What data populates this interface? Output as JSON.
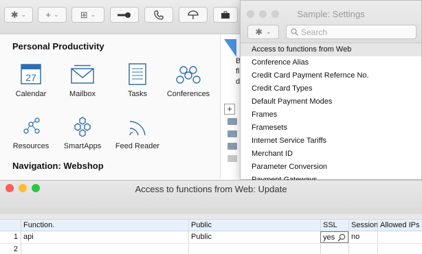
{
  "toolbar": {
    "gear_glyph": "✱",
    "add_glyph": "+",
    "grid_glyph": "⊞"
  },
  "personal": {
    "title": "Personal Productivity",
    "apps": [
      {
        "label": "Calendar",
        "badge": "27"
      },
      {
        "label": "Mailbox"
      },
      {
        "label": "Tasks"
      },
      {
        "label": "Conferences"
      },
      {
        "label": "Resources"
      },
      {
        "label": "SmartApps"
      },
      {
        "label": "Feed Reader"
      }
    ]
  },
  "navigation": {
    "title": "Navigation: Webshop"
  },
  "right_panel": {
    "lines": [
      "B",
      "fl",
      "d"
    ]
  },
  "popup": {
    "title": "Sample: Settings",
    "search_placeholder": "Search",
    "items": [
      "Access to functions from Web",
      "Conference Alias",
      "Credit Card Payment Refernce No.",
      "Credit Card Types",
      "Default Payment Modes",
      "Frames",
      "Framesets",
      "Internet Service Tariffs",
      "Merchant ID",
      "Parameter Conversion",
      "Payment Gateways"
    ],
    "selected_index": 0
  },
  "window": {
    "title": "Access to functions from Web: Update"
  },
  "grid": {
    "columns": [
      "Function.",
      "Public",
      "SSL",
      "Session",
      "Allowed IPs"
    ],
    "rows": [
      {
        "num": "1",
        "function": "api",
        "public": "Public",
        "ssl": "yes",
        "session": "no",
        "allowed_ips": ""
      },
      {
        "num": "2",
        "function": "",
        "public": "",
        "ssl": "",
        "session": "",
        "allowed_ips": ""
      }
    ]
  },
  "colors": {
    "traffic_red": "#fd5c55",
    "traffic_yellow": "#fdbd2e",
    "traffic_green": "#27c840",
    "icon_blue": "#2f6fb0",
    "header_bg": "#e8f1fb"
  }
}
